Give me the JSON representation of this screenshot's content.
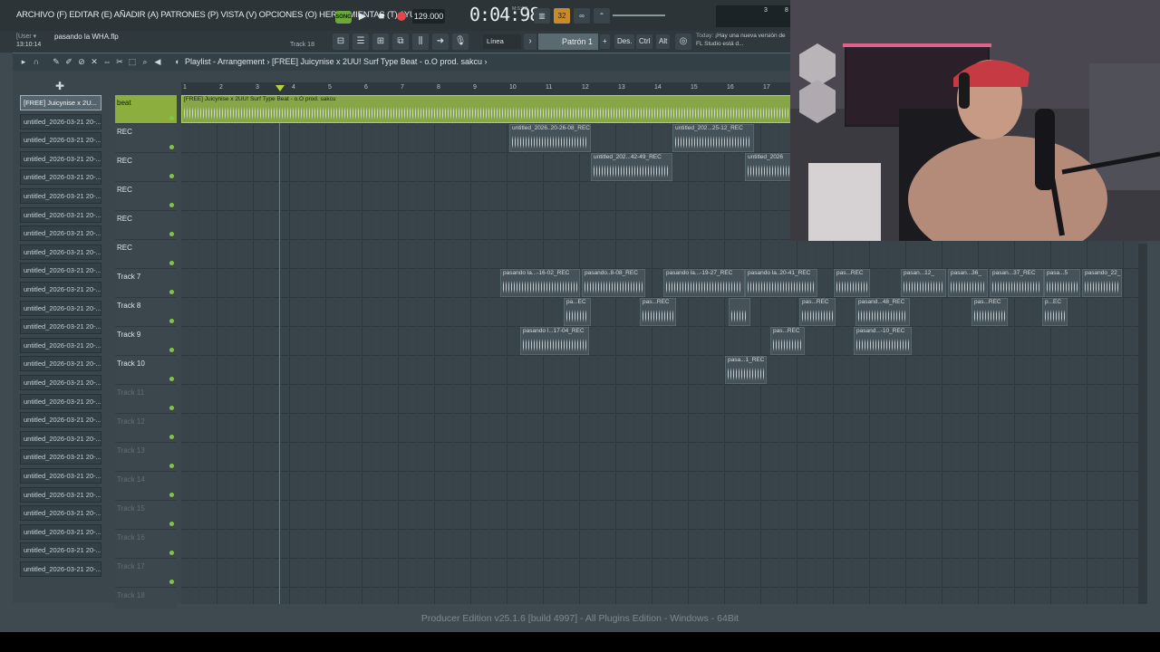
{
  "menu": {
    "text": "ARCHIVO (F) EDITAR (E) AÑADIR (A) PATRONES (P) VISTA (V) OPCIONES (O) HERRAMIENTAS (T) AYUDA"
  },
  "transport": {
    "song_label": "SONG",
    "tempo": "129.000",
    "time": "0:04:98",
    "time_unit": "M:S:CS",
    "hud_32": "32",
    "cpu_1": "3",
    "cpu_2": "8"
  },
  "info": {
    "user": "[User ▾",
    "clock": "13:10:14",
    "project": "pasando la WHA.flp",
    "track_hint": "Track 18",
    "snap": "Línea",
    "pattern": "Patrón 1",
    "btn_des": "Des.",
    "btn_ctrl": "Ctrl",
    "btn_alt": "Alt",
    "news_today": "Today:",
    "news_text": "¡Hay una nueva versión de FL Studio está d..."
  },
  "playlist": {
    "title": "Playlist - Arrangement  ›  [FREE] Juicynise x 2UU! Surf Type Beat - o.O prod. sakcu  ›",
    "bars": [
      "1",
      "2",
      "3",
      "4",
      "5",
      "6",
      "7",
      "8",
      "9",
      "10",
      "11",
      "12",
      "13",
      "14",
      "15",
      "16",
      "17"
    ],
    "clip_list": [
      "[FREE] Juicynise x 2U...",
      "untitled_2026-03-21 20-...",
      "untitled_2026-03-21 20-...",
      "untitled_2026-03-21 20-...",
      "untitled_2026-03-21 20-...",
      "untitled_2026-03-21 20-...",
      "untitled_2026-03-21 20-...",
      "untitled_2026-03-21 20-...",
      "untitled_2026-03-21 20-...",
      "untitled_2026-03-21 20-...",
      "untitled_2026-03-21 20-...",
      "untitled_2026-03-21 20-...",
      "untitled_2026-03-21 20-...",
      "untitled_2026-03-21 20-...",
      "untitled_2026-03-21 20-...",
      "untitled_2026-03-21 20-...",
      "untitled_2026-03-21 20-...",
      "untitled_2026-03-21 20-...",
      "untitled_2026-03-21 20-...",
      "untitled_2026-03-21 20-...",
      "untitled_2026-03-21 20-...",
      "untitled_2026-03-21 20-...",
      "untitled_2026-03-21 20-...",
      "untitled_2026-03-21 20-...",
      "untitled_2026-03-21 20-...",
      "untitled_2026-03-21 20-..."
    ],
    "tracks": [
      "beat",
      "REC",
      "REC",
      "REC",
      "REC",
      "REC",
      "Track 7",
      "Track 8",
      "Track 9",
      "Track 10",
      "Track 11",
      "Track 12",
      "Track 13",
      "Track 14",
      "Track 15",
      "Track 16",
      "Track 17",
      "Track 18"
    ],
    "clips": [
      {
        "label": "[FREE] Juicynise x 2UU! Surf Type Beat - o.O prod. sakcu"
      },
      {
        "label": "untitled_2026..20-26-08_REC"
      },
      {
        "label": "untitled_202...25-12_REC"
      },
      {
        "label": "untitled_202...42-49_REC"
      },
      {
        "label": "untitled_2026"
      },
      {
        "label": "pasando la...-16-02_REC"
      },
      {
        "label": "pasando..8-08_REC"
      },
      {
        "label": "pasando la...-19-27_REC"
      },
      {
        "label": "pasando la..20-41_REC"
      },
      {
        "label": "pas...REC"
      },
      {
        "label": "pasan...12_"
      },
      {
        "label": "pasan...36_"
      },
      {
        "label": "pasan...37_REC"
      },
      {
        "label": "pasa...5"
      },
      {
        "label": "pasando_22_"
      },
      {
        "label": "pas...REC"
      },
      {
        "label": "pa...EC"
      },
      {
        "label": "pas...REC"
      },
      {
        "label": ""
      },
      {
        "label": "pas...REC"
      },
      {
        "label": "pasand...48_REC"
      },
      {
        "label": "p...EC"
      },
      {
        "label": "pasando l...17-04_REC"
      },
      {
        "label": "pas...REC"
      },
      {
        "label": "pasand...-10_REC"
      },
      {
        "label": "pasa...1_REC"
      }
    ]
  },
  "status": {
    "text": "Producer Edition v25.1.6 [build 4997] - All Plugins Edition - Windows - 64Bit"
  },
  "colors": {
    "accent_green": "#86a648",
    "record_red": "#e24848",
    "hud_orange": "#c98a2b"
  }
}
